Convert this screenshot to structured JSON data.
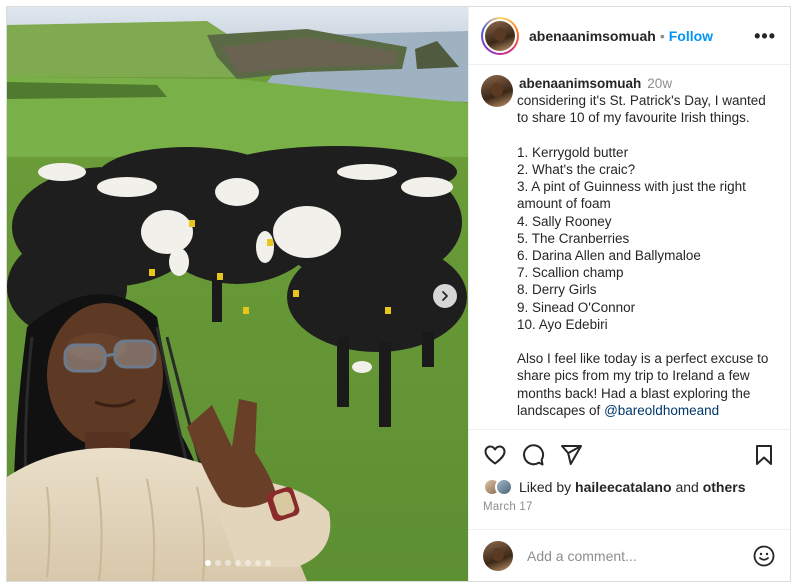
{
  "post": {
    "username": "abenaanimsomuah",
    "separator": "•",
    "follow_label": "Follow",
    "more_icon": "more-options-icon",
    "caption": {
      "username": "abenaanimsomuah",
      "time": "20w",
      "body": "considering it's St. Patrick's Day, I wanted to share 10 of my favourite Irish things.\n\n1. Kerrygold butter\n2. What's the craic?\n3. A pint of Guinness with just the right amount of foam\n4. Sally Rooney\n5. The Cranberries\n6. Darina Allen and Ballymaloe\n7. Scallion champ\n8. Derry Girls\n9. Sinead O'Connor\n10. Ayo Edebiri\n\nAlso I feel like today is a perfect excuse to share pics from my trip to Ireland a few months back! Had a blast exploring the landscapes of",
      "mention": "@bareoldhomeand"
    },
    "likes": {
      "prefix": "Liked by",
      "user": "haileecatalano",
      "connector": "and",
      "others": "others"
    },
    "date": "March 17",
    "comment_placeholder": "Add a comment...",
    "carousel": {
      "slide_count": 7,
      "active_index": 0
    },
    "icons": [
      "heart-icon",
      "comment-icon",
      "share-icon",
      "save-icon",
      "emoji-icon",
      "chevron-right-icon"
    ]
  }
}
